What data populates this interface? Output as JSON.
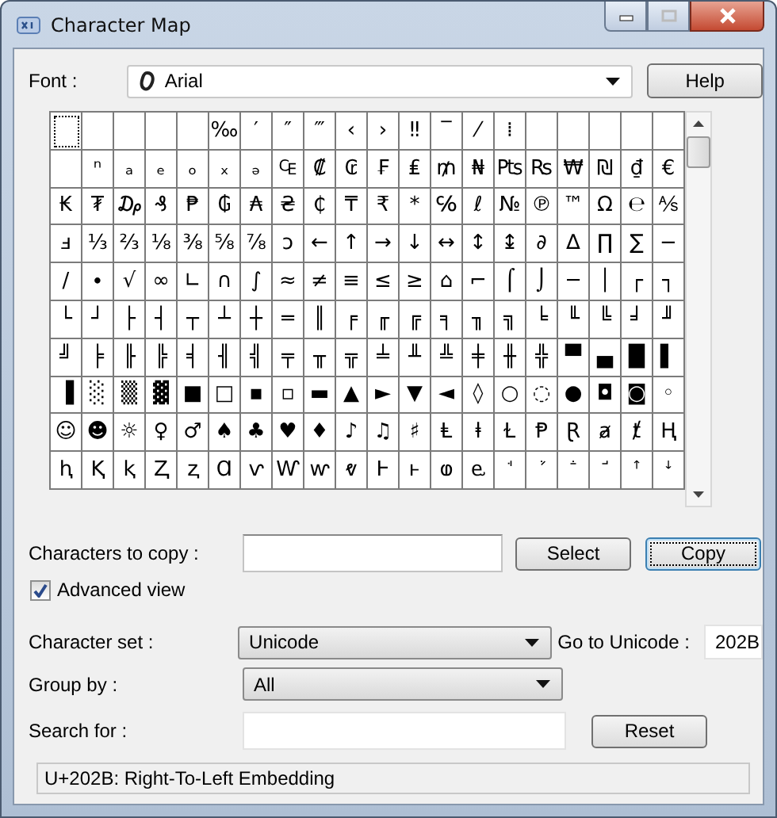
{
  "window": {
    "title": "Character Map"
  },
  "font": {
    "label": "Font :",
    "value": "Arial",
    "help": "Help"
  },
  "grid": {
    "selected": [
      [
        true,
        false,
        false,
        false,
        false,
        false,
        false,
        false,
        false,
        false,
        false,
        false,
        false,
        false,
        false,
        false,
        false,
        false,
        false,
        false
      ],
      [
        false,
        false,
        false,
        false,
        false,
        false,
        false,
        false,
        false,
        false,
        false,
        false,
        false,
        false,
        false,
        false,
        false,
        false,
        false,
        false
      ],
      [
        false,
        false,
        false,
        false,
        false,
        false,
        false,
        false,
        false,
        false,
        false,
        false,
        false,
        false,
        false,
        false,
        false,
        false,
        false,
        false
      ],
      [
        false,
        false,
        false,
        false,
        false,
        false,
        false,
        false,
        false,
        false,
        false,
        false,
        false,
        false,
        false,
        false,
        false,
        false,
        false,
        false
      ],
      [
        false,
        false,
        false,
        false,
        false,
        false,
        false,
        false,
        false,
        false,
        false,
        false,
        false,
        false,
        false,
        false,
        false,
        false,
        false,
        false
      ],
      [
        false,
        false,
        false,
        false,
        false,
        false,
        false,
        false,
        false,
        false,
        false,
        false,
        false,
        false,
        false,
        false,
        false,
        false,
        false,
        false
      ],
      [
        false,
        false,
        false,
        false,
        false,
        false,
        false,
        false,
        false,
        false,
        false,
        false,
        false,
        false,
        false,
        false,
        false,
        false,
        false,
        false
      ],
      [
        false,
        false,
        false,
        false,
        false,
        false,
        false,
        false,
        false,
        false,
        false,
        false,
        false,
        false,
        false,
        false,
        false,
        false,
        false,
        false
      ],
      [
        false,
        false,
        false,
        false,
        false,
        false,
        false,
        false,
        false,
        false,
        false,
        false,
        false,
        false,
        false,
        false,
        false,
        false,
        false,
        false
      ],
      [
        false,
        false,
        false,
        false,
        false,
        false,
        false,
        false,
        false,
        false,
        false,
        false,
        false,
        false,
        false,
        false,
        false,
        false,
        false,
        false
      ]
    ],
    "rows": [
      [
        null,
        null,
        null,
        null,
        null,
        "‰",
        "′",
        "″",
        "‴",
        "‹",
        "›",
        "‼",
        "‾",
        "⁄",
        "⁞",
        null,
        null,
        null,
        null,
        null
      ],
      [
        null,
        "ⁿ",
        "ₐ",
        "ₑ",
        "ₒ",
        "ₓ",
        "ₔ",
        "₠",
        "₡",
        "₢",
        "₣",
        "₤",
        "₥",
        "₦",
        "₧",
        "₨",
        "₩",
        "₪",
        "₫",
        "€"
      ],
      [
        "₭",
        "₮",
        "₯",
        "₰",
        "₱",
        "₲",
        "₳",
        "₴",
        "₵",
        "₸",
        "₹",
        "*",
        "℅",
        "ℓ",
        "№",
        "℗",
        "™",
        "Ω",
        "℮",
        "⅍"
      ],
      [
        "ⅎ",
        "⅓",
        "⅔",
        "⅛",
        "⅜",
        "⅝",
        "⅞",
        "ↄ",
        "←",
        "↑",
        "→",
        "↓",
        "↔",
        "↕",
        "↨",
        "∂",
        "∆",
        "∏",
        "∑",
        "−"
      ],
      [
        "∕",
        "∙",
        "√",
        "∞",
        "∟",
        "∩",
        "∫",
        "≈",
        "≠",
        "≡",
        "≤",
        "≥",
        "⌂",
        "⌐",
        "⌠",
        "⌡",
        "─",
        "│",
        "┌",
        "┐"
      ],
      [
        "└",
        "┘",
        "├",
        "┤",
        "┬",
        "┴",
        "┼",
        "═",
        "║",
        "╒",
        "╓",
        "╔",
        "╕",
        "╖",
        "╗",
        "╘",
        "╙",
        "╚",
        "╛",
        "╜"
      ],
      [
        "╝",
        "╞",
        "╟",
        "╠",
        "╡",
        "╢",
        "╣",
        "╤",
        "╥",
        "╦",
        "╧",
        "╨",
        "╩",
        "╪",
        "╫",
        "╬",
        "▀",
        "▄",
        "█",
        "▌"
      ],
      [
        "▐",
        "░",
        "▒",
        "▓",
        "■",
        "□",
        "▪",
        "▫",
        "▬",
        "▲",
        "►",
        "▼",
        "◄",
        "◊",
        "○",
        "◌",
        "●",
        "◘",
        "◙",
        "◦"
      ],
      [
        "☺",
        "☻",
        "☼",
        "♀",
        "♂",
        "♠",
        "♣",
        "♥",
        "♦",
        "♪",
        "♫",
        "♯",
        "Ⱡ",
        "ⱡ",
        "Ɫ",
        "Ᵽ",
        "Ɽ",
        "ⱥ",
        "ⱦ",
        "Ⱨ"
      ],
      [
        "ⱨ",
        "Ⱪ",
        "ⱪ",
        "Ⱬ",
        "ⱬ",
        "Ɑ",
        "ⱱ",
        "Ⱳ",
        "ⱳ",
        "ⱴ",
        "Ⱶ",
        "ⱶ",
        "ⱷ",
        "ⱸ",
        "ꜗ",
        "ꜘ",
        "ꜙ",
        "ꜚ",
        "ꜛ",
        "ꜜ"
      ]
    ]
  },
  "copy": {
    "label": "Characters to copy :",
    "select": "Select",
    "copy": "Copy"
  },
  "advanced": {
    "label": "Advanced view",
    "checked": true
  },
  "charset": {
    "label": "Character set :",
    "value": "Unicode",
    "goto_label": "Go to Unicode :",
    "goto_value": "202B"
  },
  "group_by": {
    "label": "Group by :",
    "value": "All"
  },
  "search": {
    "label": "Search for :",
    "reset": "Reset"
  },
  "status_bar": "U+202B: Right-To-Left Embedding"
}
